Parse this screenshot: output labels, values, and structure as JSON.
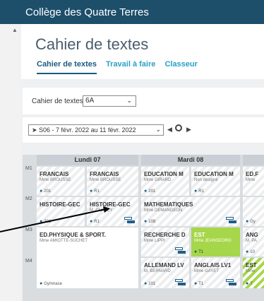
{
  "app": {
    "title": "Collège des Quatre Terres"
  },
  "page": {
    "title": "Cahier de textes"
  },
  "tabs": [
    {
      "label": "Cahier de textes",
      "active": true
    },
    {
      "label": "Travail à faire",
      "active": false
    },
    {
      "label": "Classeur",
      "active": false
    }
  ],
  "filter": {
    "label": "Cahier de textes",
    "class_value": "6A"
  },
  "week": {
    "value": "➤ S06 - 7 févr. 2022 au 11 févr. 2022"
  },
  "days": [
    {
      "label": "Lundi 07"
    },
    {
      "label": "Mardi 08"
    }
  ],
  "slots": [
    "M1",
    "M2",
    "M3",
    "M4"
  ],
  "lessons": {
    "mon_m1_a": {
      "subject": "FRANCAIS",
      "teacher": "Mme BROUSSE",
      "room": "201"
    },
    "mon_m1_b": {
      "subject": "FRANCAIS",
      "teacher": "Mme BROUSSE",
      "room": "R1"
    },
    "mon_m2_a": {
      "subject": "HISTOIRE-GEC",
      "teacher": "",
      "room": "201"
    },
    "mon_m2_b": {
      "subject": "HISTOIRE-GEC",
      "teacher": "M. CHAVEY",
      "room": "R1"
    },
    "mon_m34": {
      "subject": "ED.PHYSIQUE & SPORT.",
      "teacher": "Mme AMIOTTE-SUCHET",
      "room": "Gymnase"
    },
    "tue_m1_a": {
      "subject": "EDUCATION M",
      "teacher": "Mme GIRARD",
      "room": "201"
    },
    "tue_m1_b": {
      "subject": "EDUCATION M",
      "teacher": "Non désigné",
      "room": "R1"
    },
    "tue_m2": {
      "subject": "MATHEMATIQUES",
      "teacher": "Mme DEMANGEON",
      "room": "108"
    },
    "tue_m3_a": {
      "subject": "RECHERCHE D",
      "teacher": "Mme LIPPI",
      "room": ""
    },
    "tue_m3_b": {
      "subject": "EST",
      "teacher": "Mme JEANGEORG",
      "room": "T1"
    },
    "tue_m4_a": {
      "subject": "ALLEMAND LV",
      "teacher": "M. BERNARD",
      "room": "101"
    },
    "tue_m4_b": {
      "subject": "ANGLAIS LV1",
      "teacher": "Mme GAYET",
      "room": "T1"
    },
    "wed_m1": {
      "subject": "ED.F",
      "teacher": "Mme",
      "room": ""
    },
    "wed_m2": {
      "subject": "",
      "teacher": "",
      "room": "Gy"
    },
    "wed_m3": {
      "subject": "ANG",
      "teacher": "M. PA",
      "room": "10"
    },
    "wed_m4": {
      "subject": "EST",
      "teacher": "Mme",
      "room": "T"
    }
  },
  "colors": {
    "topbar": "#1d4f6b",
    "accent": "#2aa0c9",
    "lesson_green": "#a6d64a"
  },
  "icons": {
    "prev": "◀",
    "next": "▶",
    "chevron": "⌄",
    "pin": "●"
  }
}
